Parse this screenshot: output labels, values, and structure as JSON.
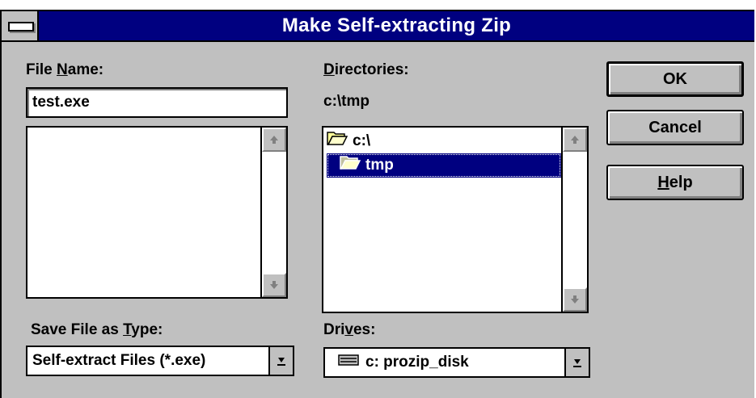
{
  "window": {
    "title": "Make Self-extracting Zip"
  },
  "file_name": {
    "label_prefix": "File ",
    "label_accel": "N",
    "label_suffix": "ame:",
    "value": "test.exe",
    "files": []
  },
  "directories": {
    "label_accel": "D",
    "label_suffix": "irectories:",
    "current_path": "c:\\tmp",
    "items": [
      {
        "label": "c:\\",
        "selected": false
      },
      {
        "label": "tmp",
        "selected": true
      }
    ]
  },
  "save_type": {
    "label_prefix": "Save File as ",
    "label_accel": "T",
    "label_suffix": "ype:",
    "selected": "Self-extract Files (*.exe)"
  },
  "drives": {
    "label_prefix": "Dri",
    "label_accel": "v",
    "label_suffix": "es:",
    "selected": "c: prozip_disk"
  },
  "buttons": {
    "ok": "OK",
    "cancel": "Cancel",
    "help_accel": "H",
    "help_suffix": "elp"
  },
  "colors": {
    "title_bar": "#000080",
    "dialog_face": "#c0c0c0",
    "selection": "#000080"
  },
  "icons": [
    "system-menu-icon",
    "scroll-up-arrow-icon",
    "scroll-down-arrow-icon",
    "open-folder-icon",
    "dropdown-arrow-icon",
    "drive-icon"
  ]
}
